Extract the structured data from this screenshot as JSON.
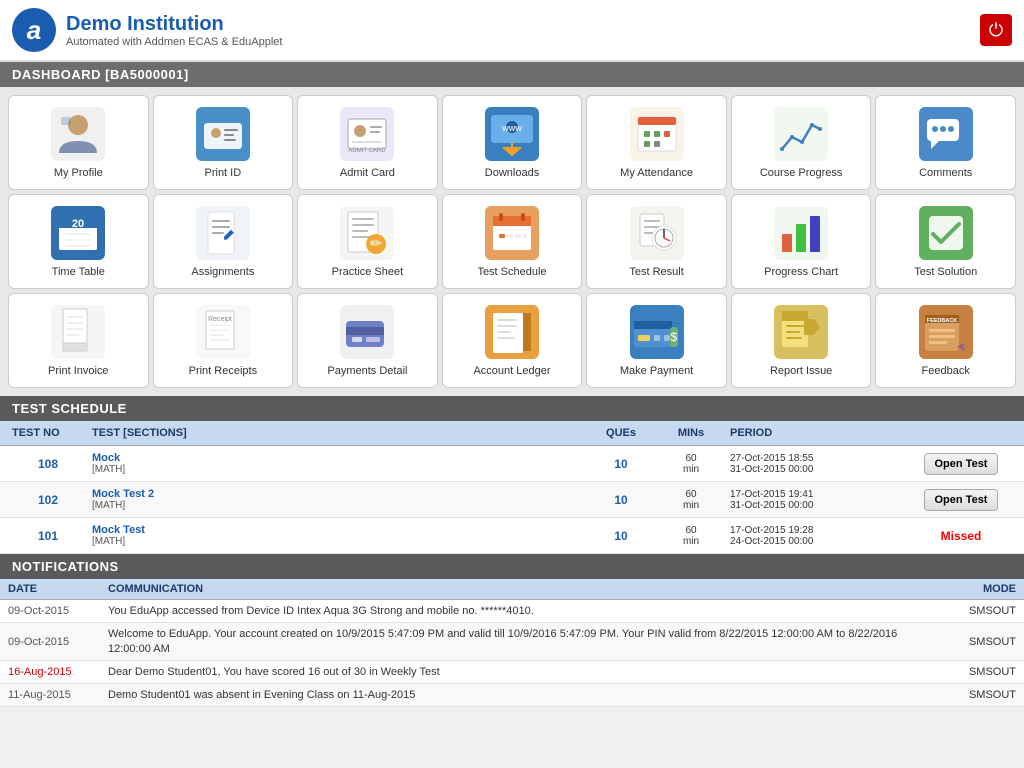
{
  "header": {
    "logo_letter": "a",
    "institution_name": "Demo Institution",
    "institution_sub": "Automated with Addmen ECAS & EduApplet",
    "power_icon": "⏻"
  },
  "dashboard": {
    "title": "DASHBOARD [BA5000001]"
  },
  "icons": [
    {
      "id": "my-profile",
      "label": "My Profile",
      "icon": "👤",
      "style": ""
    },
    {
      "id": "print-id",
      "label": "Print ID",
      "icon": "🪪",
      "style": "icon-bg-blue"
    },
    {
      "id": "admit-card",
      "label": "Admit Card",
      "icon": "🗂️",
      "style": ""
    },
    {
      "id": "downloads",
      "label": "Downloads",
      "icon": "🖥️",
      "style": "icon-bg-blue"
    },
    {
      "id": "my-attendance",
      "label": "My Attendance",
      "icon": "📊",
      "style": ""
    },
    {
      "id": "course-progress",
      "label": "Course Progress",
      "icon": "📈",
      "style": ""
    },
    {
      "id": "comments",
      "label": "Comments",
      "icon": "💬",
      "style": "icon-bg-blue"
    },
    {
      "id": "time-table",
      "label": "Time Table",
      "icon": "🗓️",
      "style": "icon-bg-blue"
    },
    {
      "id": "assignments",
      "label": "Assignments",
      "icon": "📝",
      "style": ""
    },
    {
      "id": "practice-sheet",
      "label": "Practice Sheet",
      "icon": "📋",
      "style": ""
    },
    {
      "id": "test-schedule",
      "label": "Test Schedule",
      "icon": "📅",
      "style": "icon-bg-orange"
    },
    {
      "id": "test-result",
      "label": "Test Result",
      "icon": "🔍",
      "style": ""
    },
    {
      "id": "progress-chart",
      "label": "Progress Chart",
      "icon": "📊",
      "style": "icon-bg-green"
    },
    {
      "id": "test-solution",
      "label": "Test Solution",
      "icon": "✅",
      "style": "icon-bg-green"
    },
    {
      "id": "print-invoice",
      "label": "Print Invoice",
      "icon": "🧾",
      "style": ""
    },
    {
      "id": "print-receipts",
      "label": "Print Receipts",
      "icon": "🧾",
      "style": ""
    },
    {
      "id": "payments-detail",
      "label": "Payments Detail",
      "icon": "💳",
      "style": ""
    },
    {
      "id": "account-ledger",
      "label": "Account Ledger",
      "icon": "📒",
      "style": "icon-bg-orange"
    },
    {
      "id": "make-payment",
      "label": "Make Payment",
      "icon": "💰",
      "style": "icon-bg-blue"
    },
    {
      "id": "report-issue",
      "label": "Report Issue",
      "icon": "📌",
      "style": "icon-bg-yellow"
    },
    {
      "id": "feedback",
      "label": "Feedback",
      "icon": "📦",
      "style": "icon-bg-orange"
    }
  ],
  "test_schedule": {
    "section_title": "TEST SCHEDULE",
    "columns": [
      "TEST NO",
      "TEST [SECTIONS]",
      "QUEs",
      "MINs",
      "PERIOD",
      ""
    ],
    "rows": [
      {
        "test_no": "108",
        "test_name": "Mock",
        "test_section": "[MATH]",
        "ques": "10",
        "mins": "60\nmin",
        "period": "27-Oct-2015 18:55\n31-Oct-2015 00:00",
        "action": "Open Test",
        "action_type": "button"
      },
      {
        "test_no": "102",
        "test_name": "Mock Test 2",
        "test_section": "[MATH]",
        "ques": "10",
        "mins": "60\nmin",
        "period": "17-Oct-2015 19:41\n31-Oct-2015 00:00",
        "action": "Open Test",
        "action_type": "button"
      },
      {
        "test_no": "101",
        "test_name": "Mock Test",
        "test_section": "[MATH]",
        "ques": "10",
        "mins": "60\nmin",
        "period": "17-Oct-2015 19:28\n24-Oct-2015 00:00",
        "action": "Missed",
        "action_type": "missed"
      }
    ]
  },
  "notifications": {
    "section_title": "NOTIFICATIONS",
    "columns": [
      "DATE",
      "COMMUNICATION",
      "MODE"
    ],
    "rows": [
      {
        "date": "09-Oct-2015",
        "date_color": "normal",
        "message": "You EduApp accessed from Device ID Intex Aqua 3G Strong and mobile no. ******4010.",
        "mode": "SMSOUT"
      },
      {
        "date": "09-Oct-2015",
        "date_color": "normal",
        "message": "Welcome to EduApp. Your account created on 10/9/2015 5:47:09 PM and valid till 10/9/2016 5:47:09 PM. Your PIN valid from 8/22/2015 12:00:00 AM to 8/22/2016 12:00:00 AM",
        "mode": "SMSOUT"
      },
      {
        "date": "16-Aug-2015",
        "date_color": "red",
        "message": "Dear Demo Student01, You have scored 16 out of 30 in Weekly Test",
        "mode": "SMSOUT"
      },
      {
        "date": "11-Aug-2015",
        "date_color": "normal",
        "message": "Demo Student01 was absent in Evening Class on 11-Aug-2015",
        "mode": "SMSOUT"
      }
    ]
  }
}
